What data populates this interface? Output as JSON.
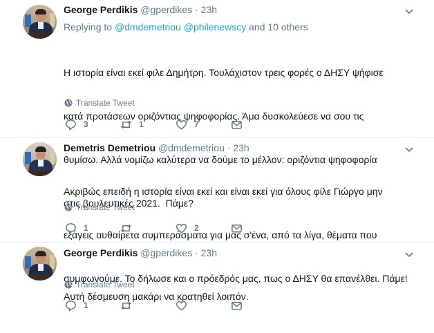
{
  "tweets": [
    {
      "name": "George Perdikis",
      "handle": "@gperdikes",
      "separator": "·",
      "time": "23h",
      "replying_prefix": "Replying to",
      "replying_mention1": "@dmdemetriou",
      "replying_mention2": "@philenewscy",
      "replying_suffix": "and 10 others",
      "text_lines": [
        "Η ιστορία είναι εκεί φιλε Δημήτρη. Τουλάχιστον τρεις φορές ο ΔΗΣΥ ψήφισε",
        "κατά προτάσεων οριζόντιας ψηφοφορίας. Άμα δυσκολεύεσε να σου τις",
        "θυμίσω. Αλλά νομίζω καλύτερα να δούμε το μέλλον: οριζόντια ψηφοφορία",
        "στις βουλευτικές 2021.  Πάμε?"
      ],
      "translate_label": "Translate Tweet",
      "reply_count": "3",
      "retweet_count": "1",
      "like_count": "7"
    },
    {
      "name": "Demetris Demetriou",
      "handle": "@dmdemetriou",
      "separator": "·",
      "time": "23h",
      "text_lines": [
        "Ακριβώς επειδή η ιστορία είναι εκεί και είναι εκεί για όλους φίλε Γιώργο μην",
        "εξάγεις αυθαίρετα συμπεράσματα για μας σ'ένα, από τα λίγα, θέματα που",
        "συμφωνούμε. Το δήλωσε και ο πρόεδρός μας, πως ο ΔΗΣΥ θα επανέλθει. Πάμε!"
      ],
      "translate_label": "Translate Tweet",
      "reply_count": "1",
      "retweet_count": "",
      "like_count": "2"
    },
    {
      "name": "George Perdikis",
      "handle": "@gperdikes",
      "separator": "·",
      "time": "23h",
      "text_lines": [
        "Αυτή δέσμευση μακάρι να κρατηθεί λοιπόν."
      ],
      "translate_label": "Translate Tweet",
      "reply_count": "1",
      "retweet_count": "",
      "like_count": ""
    }
  ],
  "icons": {
    "more": "chevron-down-icon",
    "translate": "globe-icon",
    "reply": "reply-icon",
    "retweet": "retweet-icon",
    "like": "heart-icon",
    "message": "envelope-icon"
  },
  "colors": {
    "text": "#14171a",
    "muted": "#657786",
    "link": "#1da1f2",
    "divider": "#e6ecf0"
  }
}
